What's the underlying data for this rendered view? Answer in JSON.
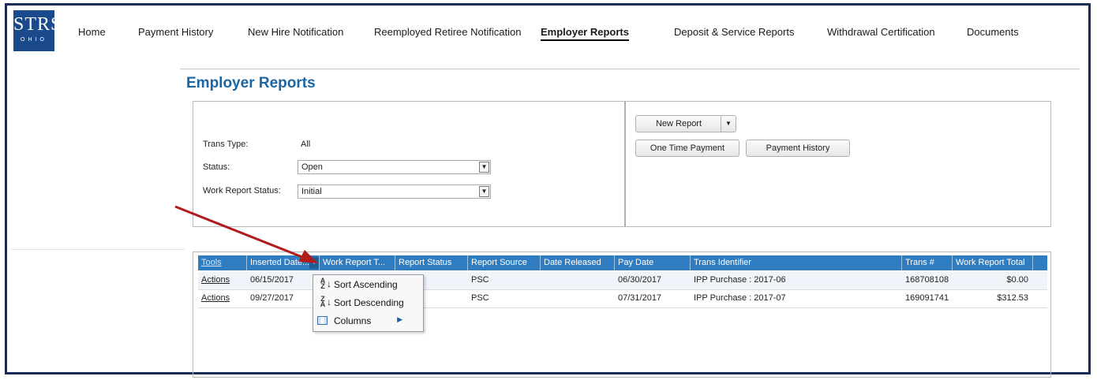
{
  "brand": {
    "logo_main": "STRS",
    "logo_sub": "OHIO"
  },
  "nav": {
    "home": "Home",
    "payment_history": "Payment History",
    "new_hire": "New Hire Notification",
    "reemployed": "Reemployed Retiree Notification",
    "employer_reports": "Employer Reports",
    "deposit": "Deposit & Service Reports",
    "withdrawal": "Withdrawal Certification",
    "documents": "Documents"
  },
  "page": {
    "title": "Employer Reports"
  },
  "filters": {
    "trans_type_label": "Trans Type:",
    "trans_type_value": "All",
    "status_label": "Status:",
    "status_value": "Open",
    "work_report_status_label": "Work Report Status:",
    "work_report_status_value": "Initial"
  },
  "actions": {
    "new_report": "New Report",
    "one_time_payment": "One Time Payment",
    "payment_history": "Payment History"
  },
  "grid": {
    "headers": {
      "tools": "Tools",
      "inserted_date": "Inserted Date...",
      "work_report_type": "Work Report T...",
      "report_status": "Report Status",
      "report_source": "Report Source",
      "date_released": "Date Released",
      "pay_date": "Pay Date",
      "trans_identifier": "Trans Identifier",
      "trans_no": "Trans #",
      "work_report_total": "Work Report Total"
    },
    "rows": [
      {
        "actions": "Actions",
        "inserted_date": "06/15/2017",
        "report_source": "PSC",
        "pay_date": "06/30/2017",
        "trans_identifier": "IPP Purchase : 2017-06",
        "trans_no": "168708108",
        "total": "$0.00"
      },
      {
        "actions": "Actions",
        "inserted_date": "09/27/2017",
        "report_source": "PSC",
        "pay_date": "07/31/2017",
        "trans_identifier": "IPP Purchase : 2017-07",
        "trans_no": "169091741",
        "total": "$312.53"
      }
    ]
  },
  "column_menu": {
    "sort_asc": "Sort Ascending",
    "sort_desc": "Sort Descending",
    "columns": "Columns"
  },
  "colors": {
    "header_blue": "#2f7dc0",
    "title_blue": "#1a66a5",
    "annotation_arrow": "#b01c1c"
  }
}
